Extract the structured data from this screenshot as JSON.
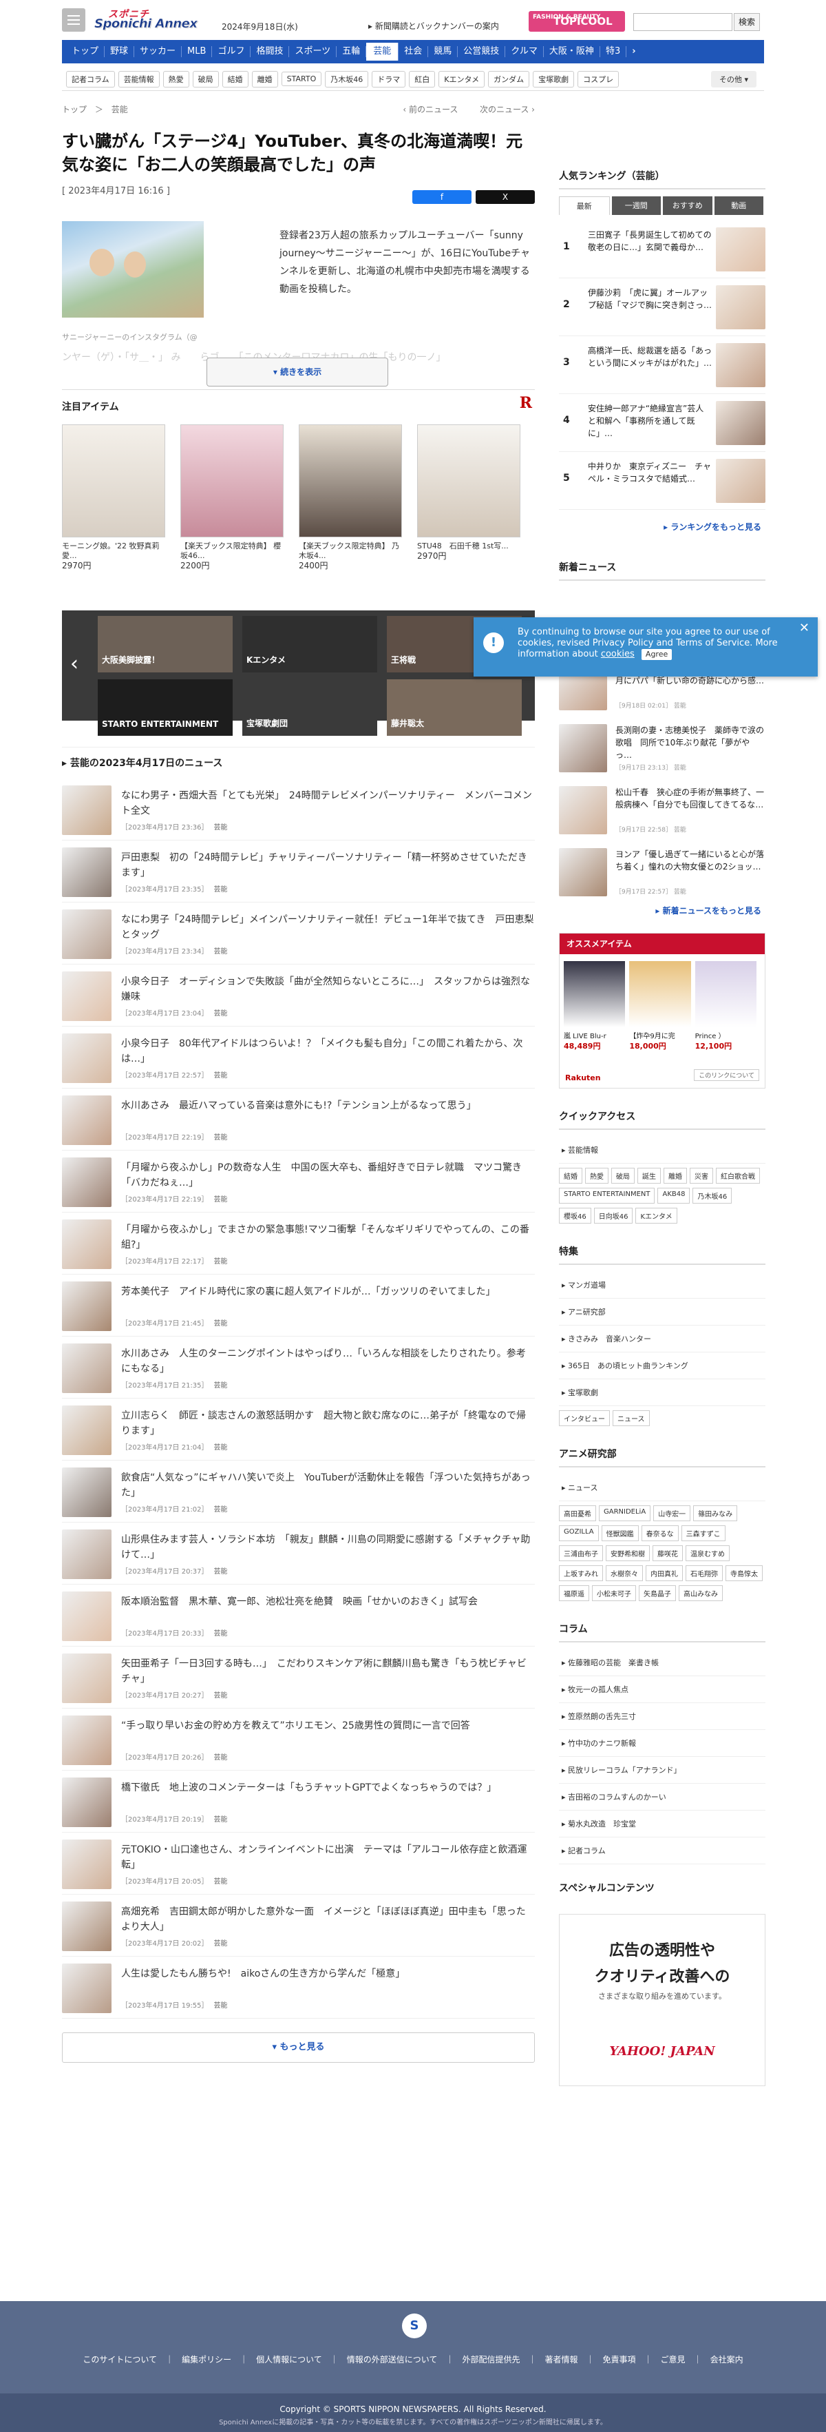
{
  "header": {
    "logo_top": "スポニチ",
    "logo_main": "Sponichi Annex",
    "date": "2024年9月18日(水)",
    "subscribe": "新聞購読とバックナンバーの案内",
    "topicool_small": "FASHION & BEAUTY",
    "topicool": "TOPICOOL",
    "search_button": "検索"
  },
  "gnav": [
    "トップ",
    "野球",
    "サッカー",
    "MLB",
    "ゴルフ",
    "格闘技",
    "スポーツ",
    "五輪",
    "芸能",
    "社会",
    "競馬",
    "公営競技",
    "クルマ",
    "大阪・阪神",
    "特3"
  ],
  "gnav_active": "芸能",
  "gnav_arrow": "›",
  "snav": [
    "記者コラム",
    "芸能情報",
    "熱愛",
    "破局",
    "結婚",
    "離婚",
    "STARTO",
    "乃木坂46",
    "ドラマ",
    "紅白",
    "Kエンタメ",
    "ガンダム",
    "宝塚歌劇",
    "コスプレ"
  ],
  "snav_more": "その他 ▾",
  "breadcrumb": [
    "トップ",
    "＞",
    "芸能"
  ],
  "prev_next": "‹ 前のニュース 　　 次のニュース ›",
  "article": {
    "title": "すい臓がん「ステージ4」YouTuber、真冬の北海道満喫！元気な姿に「お二人の笑顔最高でした」の声",
    "date": "[ 2023年4月17日 16:16 ]",
    "share1": "f",
    "share2": "X",
    "caption": "サニージャーニーのインスタグラム（@",
    "body": "登録者23万人超の旅系カップルユーチューバー「sunny　journey〜サニージャーニー〜」が、16日にYouTubeチャンネルを更新し、北海道の札幌市中央卸売市場を満喫する動画を投稿した。",
    "body_faded": "ンヤー（ゲ）・「サ＿・」 み　　らゴ　　「このメンター口マナカロ」の生「もりの一ノ」",
    "read_more": "▾ 続きを表示"
  },
  "attention": {
    "title": "注目アイテム",
    "logo": "R",
    "items": [
      {
        "name": "モーニング娘。'22 牧野真莉愛...",
        "price": "2970円"
      },
      {
        "name": "【楽天ブックス限定特典】 櫻坂46...",
        "price": "2200円"
      },
      {
        "name": "【楽天ブックス限定特典】 乃木坂4...",
        "price": "2400円"
      },
      {
        "name": "STU48　石田千穂 1st写...",
        "price": "2970円"
      }
    ]
  },
  "carousel": [
    "大阪美脚披露！",
    "Kエンタメ",
    "王将戦",
    "STARTO ENTERTAINMENT",
    "宝塚歌劇団",
    "藤井聡太"
  ],
  "news_section_title": "芸能の2023年4月17日のニュース",
  "news": [
    {
      "title": "なにわ男子・西畑大吾「とても光栄」　24時間テレビメインパーソナリティー　メンバーコメント全文",
      "time": "［2023年4月17日 23:36］",
      "cat": "芸能"
    },
    {
      "title": "戸田恵梨　初の「24時間テレビ」チャリティーパーソナリティー「精一杯努めさせていただきます」",
      "time": "［2023年4月17日 23:35］",
      "cat": "芸能"
    },
    {
      "title": "なにわ男子「24時間テレビ」メインパーソナリティー就任！デビュー1年半で抜てき　戸田恵梨とタッグ",
      "time": "［2023年4月17日 23:34］",
      "cat": "芸能"
    },
    {
      "title": "小泉今日子　オーディションで失敗談「曲が全然知らないところに…」　スタッフからは強烈な嫌味",
      "time": "［2023年4月17日 23:04］",
      "cat": "芸能"
    },
    {
      "title": "小泉今日子　80年代アイドルはつらいよ！？「メイクも髪も自分」「この間これ着たから、次は…」",
      "time": "［2023年4月17日 22:57］",
      "cat": "芸能"
    },
    {
      "title": "水川あさみ　最近ハマっている音楽は意外にも!?「テンション上がるなって思う」",
      "time": "［2023年4月17日 22:19］",
      "cat": "芸能"
    },
    {
      "title": "「月曜から夜ふかし」Pの数奇な人生　中国の医大卒も、番組好きで日テレ就職　マツコ驚き「バカだねぇ…」",
      "time": "［2023年4月17日 22:19］",
      "cat": "芸能"
    },
    {
      "title": "「月曜から夜ふかし」でまさかの緊急事態!マツコ衝撃「そんなギリギリでやってんの、この番組?」",
      "time": "［2023年4月17日 22:17］",
      "cat": "芸能"
    },
    {
      "title": "芳本美代子　アイドル時代に家の裏に超人気アイドルが…「ガッツリのぞいてました」",
      "time": "［2023年4月17日 21:45］",
      "cat": "芸能"
    },
    {
      "title": "水川あさみ　人生のターニングポイントはやっぱり…「いろんな相談をしたりされたり。参考にもなる」",
      "time": "［2023年4月17日 21:35］",
      "cat": "芸能"
    },
    {
      "title": "立川志らく　師匠・談志さんの激怒話明かす　超大物と飲む席なのに…弟子が「終電なので帰ります」",
      "time": "［2023年4月17日 21:04］",
      "cat": "芸能"
    },
    {
      "title": "飲食店“人気なっ”にギャハハ笑いで炎上　YouTuberが活動休止を報告「浮ついた気持ちがあった」",
      "time": "［2023年4月17日 21:02］",
      "cat": "芸能"
    },
    {
      "title": "山形県住みます芸人・ソラシド本坊　「親友」麒麟・川島の同期愛に感謝する「メチャクチャ助けて…」",
      "time": "［2023年4月17日 20:37］",
      "cat": "芸能"
    },
    {
      "title": "阪本順治監督　黒木華、寛一郎、池松壮亮を絶賛　映画「せかいのおきく」試写会",
      "time": "［2023年4月17日 20:33］",
      "cat": "芸能"
    },
    {
      "title": "矢田亜希子「一日3回する時も…」　こだわりスキンケア術に麒麟川島も驚き「もう枕ビチャビチャ」",
      "time": "［2023年4月17日 20:27］",
      "cat": "芸能"
    },
    {
      "title": "“手っ取り早いお金の貯め方を教えて”ホリエモン、25歳男性の質問に一言で回答",
      "time": "［2023年4月17日 20:26］",
      "cat": "芸能"
    },
    {
      "title": "橋下徹氏　地上波のコメンテーターは「もうチャットGPTでよくなっちゃうのでは？」",
      "time": "［2023年4月17日 20:19］",
      "cat": "芸能"
    },
    {
      "title": "元TOKIO・山口達也さん、オンラインイベントに出演　テーマは「アルコール依存症と飲酒運転」",
      "time": "［2023年4月17日 20:05］",
      "cat": "芸能"
    },
    {
      "title": "高畑充希　吉田鋼太郎が明かした意外な一面　イメージと「ほぼほぼ真逆」田中圭も「思ったより大人」",
      "time": "［2023年4月17日 20:02］",
      "cat": "芸能"
    },
    {
      "title": "人生は愛したもん勝ちや!　aikoさんの生き方から学んだ「極意」",
      "time": "［2023年4月17日 19:55］",
      "cat": "芸能"
    }
  ],
  "more_button": "▾ もっと見る",
  "ranking": {
    "title": "人気ランキング（芸能）",
    "tabs": [
      "最新",
      "一週間",
      "おすすめ",
      "動画"
    ],
    "rows": [
      {
        "n": "1",
        "t": "三田寛子「長男誕生して初めての敬老の日に…」玄関で義母か…"
      },
      {
        "n": "2",
        "t": "伊藤沙莉　「虎に翼」オールアップ秘話「マジで胸に突き刺さっ…"
      },
      {
        "n": "3",
        "t": "高橋洋一氏、総裁選を語る「あっという間にメッキがはがれた」…"
      },
      {
        "n": "4",
        "t": "安住紳一郎アナ“絶縁宣言”芸人と和解へ「事務所を通して既に」…"
      },
      {
        "n": "5",
        "t": "中井りか　東京ディズニー　チャペル・ミラコスタで結婚式…"
      }
    ],
    "more": "▸ ランキングをもっと見る"
  },
  "new_news": {
    "title": "新着ニュース",
    "rows": [
      {
        "t": "伊集院光のモノマネで活躍MABが来年3月にパパ「新しい命の奇跡に心から感…",
        "d": "［9月18日 02:01］ 芸能"
      },
      {
        "t": "長渕剛の妻・志穂美悦子　薬師寺で涙の歌唱　同所で10年ぶり献花「夢がやっ…",
        "d": "［9月17日 23:13］ 芸能"
      },
      {
        "t": "松山千春　狭心症の手術が無事終了、一般病棟へ「自分でも回復してきてるな…",
        "d": "［9月17日 22:58］ 芸能"
      },
      {
        "t": "ヨンア「優し過ぎて一緒にいると心が落ち着く」憧れの大物女優との2ショッ…",
        "d": "［9月17日 22:57］ 芸能"
      }
    ],
    "more": "▸ 新着ニュースをもっと見る"
  },
  "cookie": {
    "text": "By continuing to browse our site you agree to our use of cookies, revised Privacy Policy and Terms of Service. More information about ",
    "link": "cookies",
    "agree": "Agree",
    "close": "✕",
    "icon": "!"
  },
  "osusume": {
    "title": "オススメアイテム",
    "items": [
      {
        "name": "嵐 LIVE Blu-r",
        "price": "48,489円"
      },
      {
        "name": "【炸卆9月に完",
        "price": "18,000円"
      },
      {
        "name": "Prince ）",
        "price": "12,100円"
      }
    ],
    "link": "このリンクについて",
    "brand": "Rakuten"
  },
  "quick": {
    "title": "クイックアクセス",
    "head": "芸能情報",
    "tags": [
      "結婚",
      "熱愛",
      "破局",
      "誕生",
      "離婚",
      "災害",
      "紅白歌合戦",
      "STARTO ENTERTAINMENT",
      "AKB48",
      "乃木坂46",
      "櫻坂46",
      "日向坂46",
      "Kエンタメ"
    ]
  },
  "tokushu": {
    "title": "特集",
    "items": [
      "マンガ道場",
      "アニ研究部",
      "きさみみ　音楽ハンター",
      "365日　あの頃ヒット曲ランキング",
      "宝塚歌劇"
    ],
    "tags": [
      "インタビュー",
      "ニュース"
    ]
  },
  "anime": {
    "title": "アニメ研究部",
    "head": "ニュース",
    "tags": [
      "高田憂希",
      "GARNIDELiA",
      "山寺宏一",
      "篠田みなみ",
      "GOZILLA",
      "怪獣図鑑",
      "春奈るな",
      "三森すずこ",
      "三浦由布子",
      "安野希和樹",
      "藤咲花",
      "温泉むすめ",
      "上坂すみれ",
      "水樹奈々",
      "内田真礼",
      "石毛翔弥",
      "寺島惇太",
      "福原遥",
      "小松未可子",
      "矢島晶子",
      "高山みなみ"
    ]
  },
  "column": {
    "title": "コラム",
    "items": [
      "佐藤雅昭の芸能　楽書き帳",
      "牧元一の孤人焦点",
      "笠原然朗の舌先三寸",
      "竹中功のナニワ新報",
      "民放リレーコラム「アナランド」",
      "吉田裕のコラムすんのかーい",
      "菊水丸改造　珍宝堂",
      "記者コラム"
    ]
  },
  "special": {
    "title": "スペシャルコンテンツ"
  },
  "ad": {
    "line1": "広告の透明性や",
    "line2": "クオリティ改善への",
    "line3": "さまざまな取り組みを進めています。",
    "brand": "YAHOO! JAPAN"
  },
  "footer": {
    "logo": "S",
    "links": [
      "このサイトについて",
      "｜",
      "編集ポリシー",
      "｜",
      "個人情報について",
      "｜",
      "情報の外部送信について",
      "｜",
      "外部配信提供先",
      "｜",
      "著者情報",
      "｜",
      "免責事項",
      "｜",
      "ご意見",
      "｜",
      "会社案内"
    ],
    "copyright": "Copyright © SPORTS NIPPON NEWSPAPERS. All Rights Reserved.",
    "notice": "Sponichi Annexに掲載の記事・写真・カット等の転載を禁じます。すべての著作権はスポーツニッポン新聞社に帰属します。"
  },
  "colors": {
    "accent": "#1f56b8",
    "ranking_head": "#c8102e",
    "footer": "#5a6b8c"
  }
}
